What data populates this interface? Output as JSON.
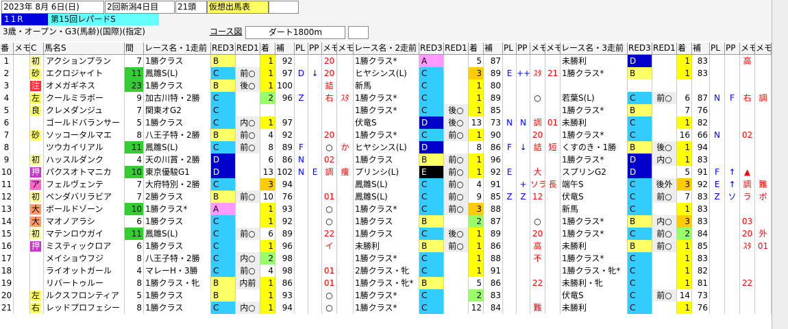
{
  "header": {
    "date": "2023年 8月 6日(日)",
    "meeting": "2回新潟4日目",
    "runners": "21頭",
    "form_label": "仮想出馬表",
    "race_no": "11R",
    "race_name": "第15回レパードS",
    "conditions": "3歳・オープン・G3(馬齢)(国際)(指定)",
    "course_label": "コース図",
    "course": "ダート1800m"
  },
  "columns": [
    "番",
    "メモ",
    "C",
    "馬名S",
    "間",
    "レース名・1走前",
    "RED3",
    "RED1",
    "着",
    "補",
    "PL",
    "PP",
    "メモ",
    "メモ",
    "レース名・2走前",
    "RED3",
    "RED1",
    "着",
    "補",
    "PL",
    "PP",
    "メモ",
    "メモ",
    "レース名・3走前",
    "RED3",
    "RED1",
    "着",
    "補",
    "PL",
    "PP",
    "メモ",
    "メモ",
    "予想"
  ],
  "rows": [
    {
      "no": "1",
      "tag": "初",
      "name": "アクションプラン",
      "int": "7",
      "r1": {
        "race": "1勝クラス",
        "red3": "B",
        "red1": "",
        "pos": "1",
        "hosei": "92",
        "pl": "",
        "pp": "",
        "m1": "20",
        "m2": ""
      },
      "r2": {
        "race": "1勝クラス*",
        "red3": "A",
        "red1": "",
        "pos": "5",
        "hosei": "87",
        "pl": "",
        "pp": "",
        "m1": "",
        "m2": ""
      },
      "r3": {
        "race": "未勝利",
        "red3": "D",
        "red1": "",
        "pos": "1",
        "hosei": "83",
        "pl": "",
        "pp": "",
        "m1": "高",
        "m2": ""
      }
    },
    {
      "no": "2",
      "tag": "砂",
      "name": "エクロジャイト",
      "int": "11",
      "r1": {
        "race": "鳳雛S(L)",
        "red3": "C",
        "red1": "前○",
        "pos": "1",
        "hosei": "97",
        "pl": "D",
        "pp": "↓",
        "m1": "20",
        "m2": ""
      },
      "r2": {
        "race": "ヒヤシンス(L)",
        "red3": "C",
        "red1": "",
        "pos": "3",
        "hosei": "89",
        "pl": "E",
        "pp": "++",
        "m1": "ｽﾀ",
        "m2": "21"
      },
      "r3": {
        "race": "1勝クラス*",
        "red3": "B",
        "red1": "",
        "pos": "1",
        "hosei": "83",
        "pl": "",
        "pp": "",
        "m1": "",
        "m2": ""
      }
    },
    {
      "no": "3",
      "tag": "注",
      "name": "オメガギネス",
      "int": "23",
      "r1": {
        "race": "1勝クラス",
        "red3": "B",
        "red1": "後○",
        "pos": "1",
        "hosei": "100",
        "pl": "",
        "pp": "",
        "m1": "詰",
        "m2": ""
      },
      "r2": {
        "race": "新馬",
        "red3": "C",
        "red1": "",
        "pos": "1",
        "hosei": "80",
        "pl": "",
        "pp": "",
        "m1": "",
        "m2": ""
      },
      "r3": {
        "race": "",
        "red3": "",
        "red1": "",
        "pos": "",
        "hosei": "",
        "pl": "",
        "pp": "",
        "m1": "",
        "m2": ""
      }
    },
    {
      "no": "4",
      "tag": "左",
      "name": "クールミラボー",
      "int": "9",
      "r1": {
        "race": "加古川特・2勝",
        "red3": "C",
        "red1": "",
        "pos": "2",
        "hosei": "96",
        "pl": "Z",
        "pp": "",
        "m1": "右",
        "m2": "ｽﾀ"
      },
      "r2": {
        "race": "1勝クラス*",
        "red3": "C",
        "red1": "",
        "pos": "1",
        "hosei": "89",
        "pl": "",
        "pp": "",
        "m1": "○",
        "m2": ""
      },
      "r3": {
        "race": "若葉S(L)",
        "red3": "C",
        "red1": "前○",
        "pos": "6",
        "hosei": "87",
        "pl": "N",
        "pp": "F",
        "m1": "右",
        "m2": "調"
      }
    },
    {
      "no": "5",
      "tag": "良",
      "name": "クレメダンジュ",
      "int": "7",
      "r1": {
        "race": "関東オG2",
        "red3": "C",
        "red1": "",
        "pos": "",
        "hosei": "",
        "pl": "",
        "pp": "",
        "m1": "",
        "m2": ""
      },
      "r2": {
        "race": "1勝クラス*",
        "red3": "C",
        "red1": "後○",
        "pos": "1",
        "hosei": "85",
        "pl": "",
        "pp": "",
        "m1": "",
        "m2": ""
      },
      "r3": {
        "race": "1勝クラス*",
        "red3": "B",
        "red1": "",
        "pos": "7",
        "hosei": "76",
        "pl": "",
        "pp": "",
        "m1": "",
        "m2": ""
      }
    },
    {
      "no": "6",
      "tag": "",
      "name": "ゴールドバランサー",
      "int": "5",
      "r1": {
        "race": "1勝クラス",
        "red3": "C",
        "red1": "内○",
        "pos": "1",
        "hosei": "97",
        "pl": "",
        "pp": "",
        "m1": "",
        "m2": ""
      },
      "r2": {
        "race": "伏竜S",
        "red3": "D",
        "red1": "後○",
        "pos": "13",
        "hosei": "73",
        "pl": "N",
        "pp": "N",
        "m1": "調",
        "m2": "01"
      },
      "r3": {
        "race": "未勝利",
        "red3": "C",
        "red1": "",
        "pos": "1",
        "hosei": "82",
        "pl": "",
        "pp": "",
        "m1": "",
        "m2": ""
      }
    },
    {
      "no": "7",
      "tag": "砂",
      "name": "ソッコータルマエ",
      "int": "8",
      "r1": {
        "race": "八王子特・2勝",
        "red3": "B",
        "red1": "前○",
        "pos": "4",
        "hosei": "92",
        "pl": "",
        "pp": "",
        "m1": "20",
        "m2": ""
      },
      "r2": {
        "race": "1勝クラス*",
        "red3": "C",
        "red1": "前○",
        "pos": "1",
        "hosei": "90",
        "pl": "",
        "pp": "",
        "m1": "20",
        "m2": ""
      },
      "r3": {
        "race": "1勝クラス*",
        "red3": "C",
        "red1": "",
        "pos": "16",
        "hosei": "66",
        "pl": "N",
        "pp": "",
        "m1": "02",
        "m2": ""
      }
    },
    {
      "no": "8",
      "tag": "",
      "name": "ツウカイリアル",
      "int": "11",
      "r1": {
        "race": "鳳雛S(L)",
        "red3": "C",
        "red1": "前○",
        "pos": "8",
        "hosei": "89",
        "pl": "F",
        "pp": "",
        "m1": "○",
        "m2": "か"
      },
      "r2": {
        "race": "ヒヤシンス(L)",
        "red3": "D",
        "red1": "",
        "pos": "8",
        "hosei": "86",
        "pl": "F",
        "pp": "↓",
        "m1": "詰",
        "m2": "短"
      },
      "r3": {
        "race": "くすのき・1勝",
        "red3": "B",
        "red1": "後○",
        "pos": "1",
        "hosei": "94",
        "pl": "",
        "pp": "",
        "m1": "",
        "m2": ""
      }
    },
    {
      "no": "9",
      "tag": "初",
      "name": "ハッスルダンク",
      "int": "4",
      "r1": {
        "race": "天の川賞・2勝",
        "red3": "D",
        "red1": "",
        "pos": "6",
        "hosei": "86",
        "pl": "N",
        "pp": "",
        "m1": "02",
        "m2": ""
      },
      "r2": {
        "race": "1勝クラス",
        "red3": "B",
        "red1": "前○",
        "pos": "1",
        "hosei": "96",
        "pl": "",
        "pp": "",
        "m1": "",
        "m2": ""
      },
      "r3": {
        "race": "1勝クラス*",
        "red3": "D",
        "red1": "内○",
        "pos": "1",
        "hosei": "83",
        "pl": "",
        "pp": "",
        "m1": "",
        "m2": ""
      }
    },
    {
      "no": "10",
      "tag": "押",
      "name": "パクスオトマニカ",
      "int": "10",
      "r1": {
        "race": "東京優駿G1",
        "red3": "D",
        "red1": "",
        "pos": "13",
        "hosei": "102",
        "pl": "N",
        "pp": "E",
        "m1": "調",
        "m2": "痩"
      },
      "r2": {
        "race": "プリンシ(L)",
        "red3": "E",
        "red1": "前○",
        "pos": "1",
        "hosei": "92",
        "pl": "E",
        "pp": "",
        "m1": "大",
        "m2": ""
      },
      "r3": {
        "race": "スプリンG2",
        "red3": "D",
        "red1": "",
        "pos": "5",
        "hosei": "91",
        "pl": "F",
        "pp": "↑",
        "m1": "▲",
        "m2": ""
      }
    },
    {
      "no": "11",
      "tag": "ア",
      "name": "フェルヴェンテ",
      "int": "7",
      "r1": {
        "race": "大府特別・2勝",
        "red3": "C",
        "red1": "",
        "pos": "3",
        "hosei": "94",
        "pl": "",
        "pp": "",
        "m1": "",
        "m2": ""
      },
      "r2": {
        "race": "鳳雛S(L)",
        "red3": "C",
        "red1": "前○",
        "pos": "4",
        "hosei": "91",
        "pl": "",
        "pp": "+",
        "m1": "ソラ",
        "m2": "長"
      },
      "r3": {
        "race": "端午S",
        "red3": "C",
        "red1": "後外",
        "pos": "3",
        "hosei": "92",
        "pl": "E",
        "pp": "↑",
        "m1": "調",
        "m2": "難"
      }
    },
    {
      "no": "12",
      "tag": "初",
      "name": "ペンダバリラビア",
      "int": "7",
      "r1": {
        "race": "2勝クラス",
        "red3": "B",
        "red1": "前○",
        "pos": "10",
        "hosei": "76",
        "pl": "",
        "pp": "",
        "m1": "01",
        "m2": ""
      },
      "r2": {
        "race": "鳳雛S(L)",
        "red3": "C",
        "red1": "前○",
        "pos": "9",
        "hosei": "85",
        "pl": "Z",
        "pp": "Z",
        "m1": "12",
        "m2": ""
      },
      "r3": {
        "race": "伏竜S",
        "red3": "C",
        "red1": "前○",
        "pos": "7",
        "hosei": "83",
        "pl": "Z",
        "pp": "ソ",
        "m1": "ラ",
        "m2": "ボ"
      }
    },
    {
      "no": "13",
      "tag": "大",
      "name": "ボールドゾーン",
      "int": "10",
      "r1": {
        "race": "1勝クラス*",
        "red3": "A",
        "red1": "",
        "pos": "1",
        "hosei": "93",
        "pl": "",
        "pp": "",
        "m1": "○",
        "m2": ""
      },
      "r2": {
        "race": "1勝クラス*",
        "red3": "C",
        "red1": "前○",
        "pos": "3",
        "hosei": "88",
        "pl": "",
        "pp": "",
        "m1": "",
        "m2": ""
      },
      "r3": {
        "race": "新馬",
        "red3": "C",
        "red1": "",
        "pos": "1",
        "hosei": "83",
        "pl": "",
        "pp": "",
        "m1": "",
        "m2": ""
      }
    },
    {
      "no": "14",
      "tag": "大",
      "name": "マオノアラシ",
      "int": "6",
      "r1": {
        "race": "1勝クラス",
        "red3": "C",
        "red1": "",
        "pos": "1",
        "hosei": "92",
        "pl": "",
        "pp": "",
        "m1": "○",
        "m2": ""
      },
      "r2": {
        "race": "1勝クラス",
        "red3": "B",
        "red1": "",
        "pos": "2",
        "hosei": "87",
        "pl": "",
        "pp": "",
        "m1": "○",
        "m2": ""
      },
      "r3": {
        "race": "1勝クラス*",
        "red3": "B",
        "red1": "内○",
        "pos": "3",
        "hosei": "83",
        "pl": "",
        "pp": "",
        "m1": "03",
        "m2": ""
      }
    },
    {
      "no": "15",
      "tag": "初",
      "name": "マテンロウガイ",
      "int": "11",
      "r1": {
        "race": "鳳雛S(L)",
        "red3": "C",
        "red1": "前○",
        "pos": "6",
        "hosei": "89",
        "pl": "",
        "pp": "",
        "m1": "22",
        "m2": ""
      },
      "r2": {
        "race": "1勝クラス",
        "red3": "C",
        "red1": "後○",
        "pos": "1",
        "hosei": "89",
        "pl": "",
        "pp": "",
        "m1": "20",
        "m2": ""
      },
      "r3": {
        "race": "1勝クラス*",
        "red3": "C",
        "red1": "前○",
        "pos": "2",
        "hosei": "84",
        "pl": "",
        "pp": "",
        "m1": "20",
        "m2": "外"
      }
    },
    {
      "no": "16",
      "tag": "押",
      "name": "ミスティックロア",
      "int": "6",
      "r1": {
        "race": "1勝クラス",
        "red3": "C",
        "red1": "",
        "pos": "1",
        "hosei": "96",
        "pl": "",
        "pp": "",
        "m1": "イ",
        "m2": ""
      },
      "r2": {
        "race": "未勝利",
        "red3": "B",
        "red1": "前○",
        "pos": "1",
        "hosei": "86",
        "pl": "",
        "pp": "",
        "m1": "高",
        "m2": ""
      },
      "r3": {
        "race": "未勝利",
        "red3": "B",
        "red1": "前○",
        "pos": "1",
        "hosei": "85",
        "pl": "",
        "pp": "",
        "m1": "ｽﾀ",
        "m2": "01"
      }
    },
    {
      "no": "17",
      "tag": "",
      "name": "メイショウフジ",
      "int": "8",
      "r1": {
        "race": "八王子特・2勝",
        "red3": "C",
        "red1": "内○",
        "pos": "2",
        "hosei": "98",
        "pl": "",
        "pp": "",
        "m1": "",
        "m2": ""
      },
      "r2": {
        "race": "1勝クラス*",
        "red3": "C",
        "red1": "",
        "pos": "1",
        "hosei": "88",
        "pl": "",
        "pp": "",
        "m1": "不",
        "m2": ""
      },
      "r3": {
        "race": "1勝クラス*",
        "red3": "C",
        "red1": "",
        "pos": "1",
        "hosei": "83",
        "pl": "",
        "pp": "",
        "m1": "",
        "m2": ""
      }
    },
    {
      "no": "18",
      "tag": "",
      "name": "ライオットガール",
      "int": "4",
      "r1": {
        "race": "マレーH・3勝",
        "red3": "C",
        "red1": "前○",
        "pos": "4",
        "hosei": "98",
        "pl": "",
        "pp": "",
        "m1": "01",
        "m2": ""
      },
      "r2": {
        "race": "2勝クラス・牝",
        "red3": "C",
        "red1": "",
        "pos": "1",
        "hosei": "91",
        "pl": "",
        "pp": "",
        "m1": "",
        "m2": ""
      },
      "r3": {
        "race": "1勝クラス・牝*",
        "red3": "C",
        "red1": "",
        "pos": "1",
        "hosei": "82",
        "pl": "",
        "pp": "",
        "m1": "",
        "m2": ""
      }
    },
    {
      "no": "19",
      "tag": "",
      "name": "リバートゥルー",
      "int": "8",
      "r1": {
        "race": "1勝クラス・牝",
        "red3": "B",
        "red1": "内前",
        "pos": "1",
        "hosei": "86",
        "pl": "",
        "pp": "",
        "m1": "01",
        "m2": ""
      },
      "r2": {
        "race": "1勝クラス・牝*",
        "red3": "B",
        "red1": "",
        "pos": "5",
        "hosei": "86",
        "pl": "",
        "pp": "",
        "m1": "22",
        "m2": ""
      },
      "r3": {
        "race": "未勝利・牝",
        "red3": "C",
        "red1": "",
        "pos": "1",
        "hosei": "81",
        "pl": "",
        "pp": "",
        "m1": "22",
        "m2": ""
      }
    },
    {
      "no": "20",
      "tag": "左",
      "name": "ルクスフロンティア",
      "int": "5",
      "r1": {
        "race": "1勝クラス",
        "red3": "B",
        "red1": "",
        "pos": "1",
        "hosei": "93",
        "pl": "",
        "pp": "",
        "m1": "○",
        "m2": ""
      },
      "r2": {
        "race": "1勝クラス*",
        "red3": "C",
        "red1": "",
        "pos": "2",
        "hosei": "83",
        "pl": "",
        "pp": "",
        "m1": "",
        "m2": ""
      },
      "r3": {
        "race": "伏竜S",
        "red3": "C",
        "red1": "前○",
        "pos": "14",
        "hosei": "73",
        "pl": "",
        "pp": "",
        "m1": "",
        "m2": ""
      }
    },
    {
      "no": "21",
      "tag": "右",
      "name": "レッドプロフェシー",
      "int": "8",
      "r1": {
        "race": "1勝クラス",
        "red3": "C",
        "red1": "内○",
        "pos": "1",
        "hosei": "94",
        "pl": "",
        "pp": "",
        "m1": "○",
        "m2": ""
      },
      "r2": {
        "race": "1勝クラス*",
        "red3": "C",
        "red1": "",
        "pos": "12",
        "hosei": "84",
        "pl": "",
        "pp": "",
        "m1": "難",
        "m2": ""
      },
      "r3": {
        "race": "未勝利",
        "red3": "C",
        "red1": "",
        "pos": "1",
        "hosei": "76",
        "pl": "",
        "pp": "",
        "m1": "",
        "m2": ""
      }
    }
  ],
  "colors": {
    "grade_A": "#ff99ff",
    "grade_B": "#ffff66",
    "grade_C": "#33ccff",
    "grade_D": "#0000cc",
    "grade_E": "#000000",
    "pos_1": "#ffff00",
    "pos_2": "#99ff66",
    "pos_3": "#ffcc00",
    "tag_初": "#ffff99",
    "tag_砂": "#ffff66",
    "tag_注": "#ff3333",
    "tag_左": "#ffff66",
    "tag_良": "#ffff66",
    "tag_押": "#cc33cc",
    "tag_ア": "#ff66cc",
    "tag_大": "#ff9966",
    "tag_右": "#ffff66",
    "memo_red": "#ff0000",
    "memo_green": "#009900",
    "memo_blue": "#0000ff",
    "race_blue": "#0000ff",
    "race_red": "#ff0000"
  }
}
